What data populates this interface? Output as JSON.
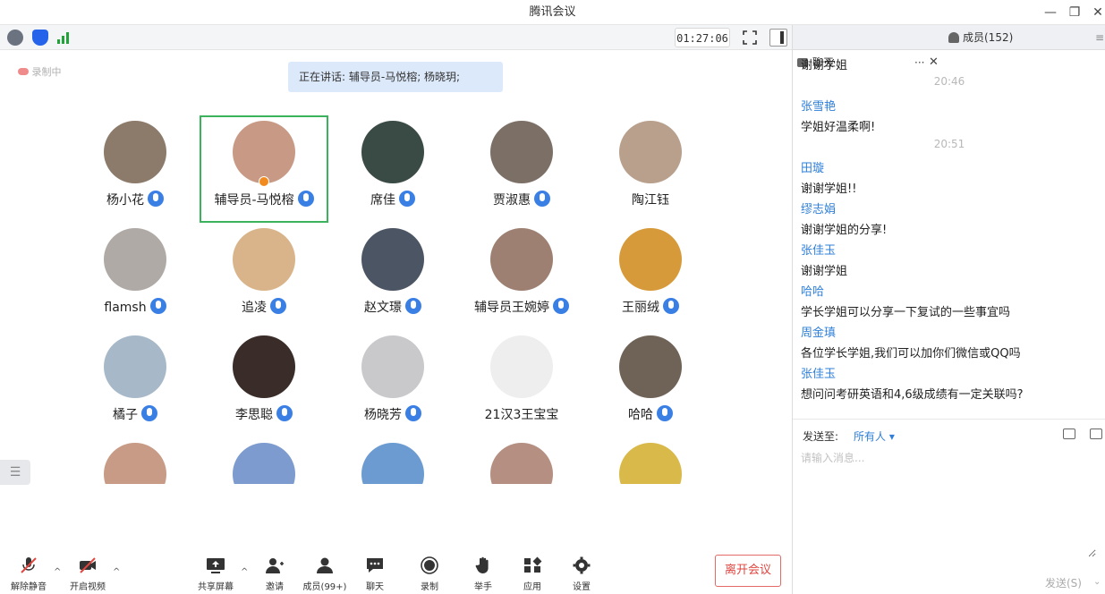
{
  "window": {
    "title": "腾讯会议"
  },
  "toolbar": {
    "timer": "01:27:06"
  },
  "stage": {
    "recording_label": "录制中",
    "speaking": "正在讲话: 辅导员-马悦榕; 杨晓玥;"
  },
  "participants": [
    {
      "name": "杨小花",
      "mic": true,
      "color": "#8c7a6a"
    },
    {
      "name": "辅导员-马悦榕",
      "mic": true,
      "color": "#c89a86",
      "active": true
    },
    {
      "name": "席佳",
      "mic": true,
      "color": "#3a4a45"
    },
    {
      "name": "贾淑惠",
      "mic": true,
      "color": "#7c6f66"
    },
    {
      "name": "陶江钰",
      "mic": false,
      "color": "#b8a08c"
    },
    {
      "name": "flamsh",
      "mic": true,
      "color": "#b0aaa6"
    },
    {
      "name": "追凌",
      "mic": true,
      "color": "#d9b48a"
    },
    {
      "name": "赵文璟",
      "mic": true,
      "color": "#4b5563"
    },
    {
      "name": "辅导员王婉婷",
      "mic": true,
      "color": "#9d8072"
    },
    {
      "name": "王丽绒",
      "mic": true,
      "color": "#d79a3a"
    },
    {
      "name": "橘子",
      "mic": true,
      "color": "#a7b9c9"
    },
    {
      "name": "李思聪",
      "mic": true,
      "color": "#3a2c28"
    },
    {
      "name": "杨晓芳",
      "mic": true,
      "color": "#c9c9cc"
    },
    {
      "name": "21汉3王宝宝",
      "mic": false,
      "color": "#eeeeee"
    },
    {
      "name": "哈哈",
      "mic": true,
      "color": "#6f6257"
    },
    {
      "name": "",
      "mic": false,
      "color": "#c89b86"
    },
    {
      "name": "",
      "mic": false,
      "color": "#7d9bcf"
    },
    {
      "name": "",
      "mic": false,
      "color": "#6b9bd1"
    },
    {
      "name": "",
      "mic": false,
      "color": "#b58f82"
    },
    {
      "name": "",
      "mic": false,
      "color": "#d8b94a"
    }
  ],
  "controls": {
    "unmute": "解除静音",
    "start_video": "开启视频",
    "share_screen": "共享屏幕",
    "invite": "邀请",
    "members": "成员(99+)",
    "chat": "聊天",
    "record": "录制",
    "raise_hand": "举手",
    "apps": "应用",
    "settings": "设置",
    "leave": "离开会议"
  },
  "side_tab_glyph": "☰",
  "panel": {
    "chat_tab": "聊天",
    "members_tab": "成员(152)",
    "more_glyph": "···",
    "close_glyph": "✕",
    "menu_glyph": "≡"
  },
  "chat": {
    "messages": [
      {
        "kind": "text",
        "text": "谢谢学姐"
      },
      {
        "kind": "time",
        "text": "20:46"
      },
      {
        "kind": "sender",
        "text": "张雪艳"
      },
      {
        "kind": "text",
        "text": "学姐好温柔啊!"
      },
      {
        "kind": "time",
        "text": "20:51"
      },
      {
        "kind": "sender",
        "text": "田璇"
      },
      {
        "kind": "text",
        "text": "谢谢学姐!!"
      },
      {
        "kind": "sender",
        "text": "缪志娟"
      },
      {
        "kind": "text",
        "text": "谢谢学姐的分享!"
      },
      {
        "kind": "sender",
        "text": "张佳玉"
      },
      {
        "kind": "text",
        "text": "谢谢学姐"
      },
      {
        "kind": "sender",
        "text": "哈哈"
      },
      {
        "kind": "text",
        "text": "学长学姐可以分享一下复试的一些事宜吗"
      },
      {
        "kind": "sender",
        "text": "周金瑱"
      },
      {
        "kind": "text",
        "text": "各位学长学姐,我们可以加你们微信或QQ吗"
      },
      {
        "kind": "sender",
        "text": "张佳玉"
      },
      {
        "kind": "text",
        "text": "想问问考研英语和4,6级成绩有一定关联吗?"
      }
    ]
  },
  "composer": {
    "send_to_label": "发送至:",
    "send_to_value": "所有人 ▾",
    "placeholder": "请输入消息...",
    "send_label": "发送(S)",
    "send_caret": "⌄"
  },
  "colors": {
    "accent": "#2e7fd9",
    "mic": "#3a7fe4",
    "active_border": "#3bb35c",
    "leave": "#e0453f"
  }
}
